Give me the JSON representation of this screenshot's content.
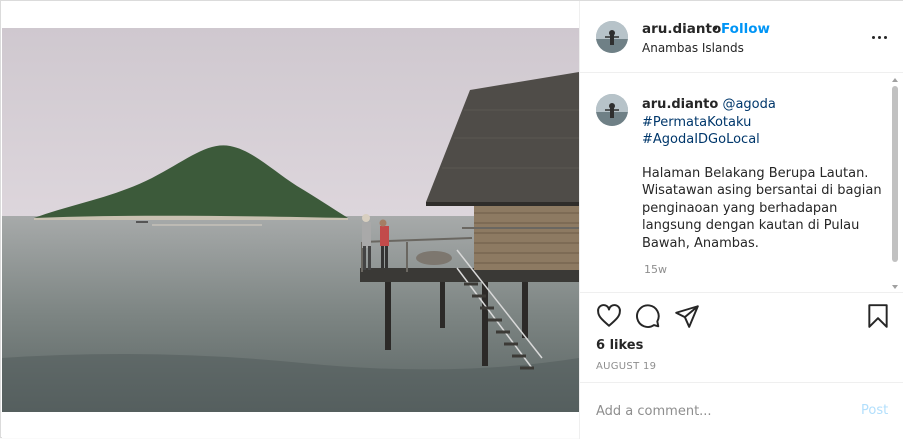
{
  "post": {
    "username": "aru.dianto",
    "separator": "•",
    "follow_label": "Follow",
    "location": "Anambas Islands"
  },
  "caption": {
    "username": "aru.dianto",
    "mention": "@agoda",
    "hashtags": [
      "#PermataKotaku",
      "#AgodaIDGoLocal"
    ],
    "text": "Halaman Belakang Berupa Lautan. Wisatawan asing bersantai di bagian penginaoan yang berhadapan langsung dengan kautan di Pulau Bawah, Anambas.",
    "time_ago": "15w"
  },
  "actions": {
    "icons": [
      "heart-icon",
      "comment-icon",
      "share-icon",
      "bookmark-icon"
    ]
  },
  "likes": "6 likes",
  "date": "AUGUST 19",
  "comment": {
    "placeholder": "Add a comment...",
    "post_label": "Post"
  },
  "colors": {
    "accent": "#0095f6",
    "post_disabled": "#b2dffc",
    "link": "#00376b",
    "muted": "#8e8e8e"
  }
}
